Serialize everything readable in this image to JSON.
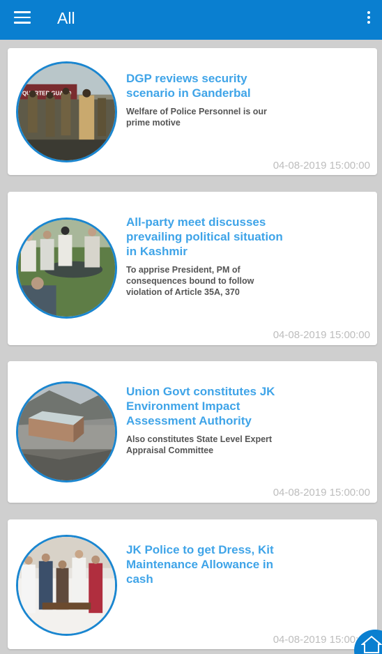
{
  "appbar": {
    "title": "All",
    "menu_icon": "hamburger-menu-icon",
    "overflow_icon": "more-vert-icon",
    "color": "#0a7fd0"
  },
  "news": [
    {
      "headline": "DGP reviews security scenario in Ganderbal",
      "summary": " Welfare of Police Personnel is our prime motive",
      "timestamp": "04-08-2019 15:00:00",
      "image_sign": "QUARTER GUARD"
    },
    {
      "headline": "All-party meet discusses prevailing political situation in Kashmir",
      "summary": "To apprise President, PM of consequences bound to follow violation of Article 35A, 370",
      "timestamp": "04-08-2019 15:00:00"
    },
    {
      "headline": "Union Govt constitutes JK Environment Impact Assessment Authority",
      "summary": "Also constitutes State Level Expert Appraisal Committee",
      "timestamp": "04-08-2019 15:00:00"
    },
    {
      "headline": "JK Police to get Dress, Kit Maintenance Allowance in cash",
      "summary": "",
      "timestamp": "04-08-2019 15:00:00"
    }
  ],
  "fab": {
    "icon": "home-icon"
  },
  "colors": {
    "headline": "#3fa4e8",
    "summary": "#555555",
    "timestamp": "#bdbdbd",
    "accent": "#1a86d0"
  }
}
